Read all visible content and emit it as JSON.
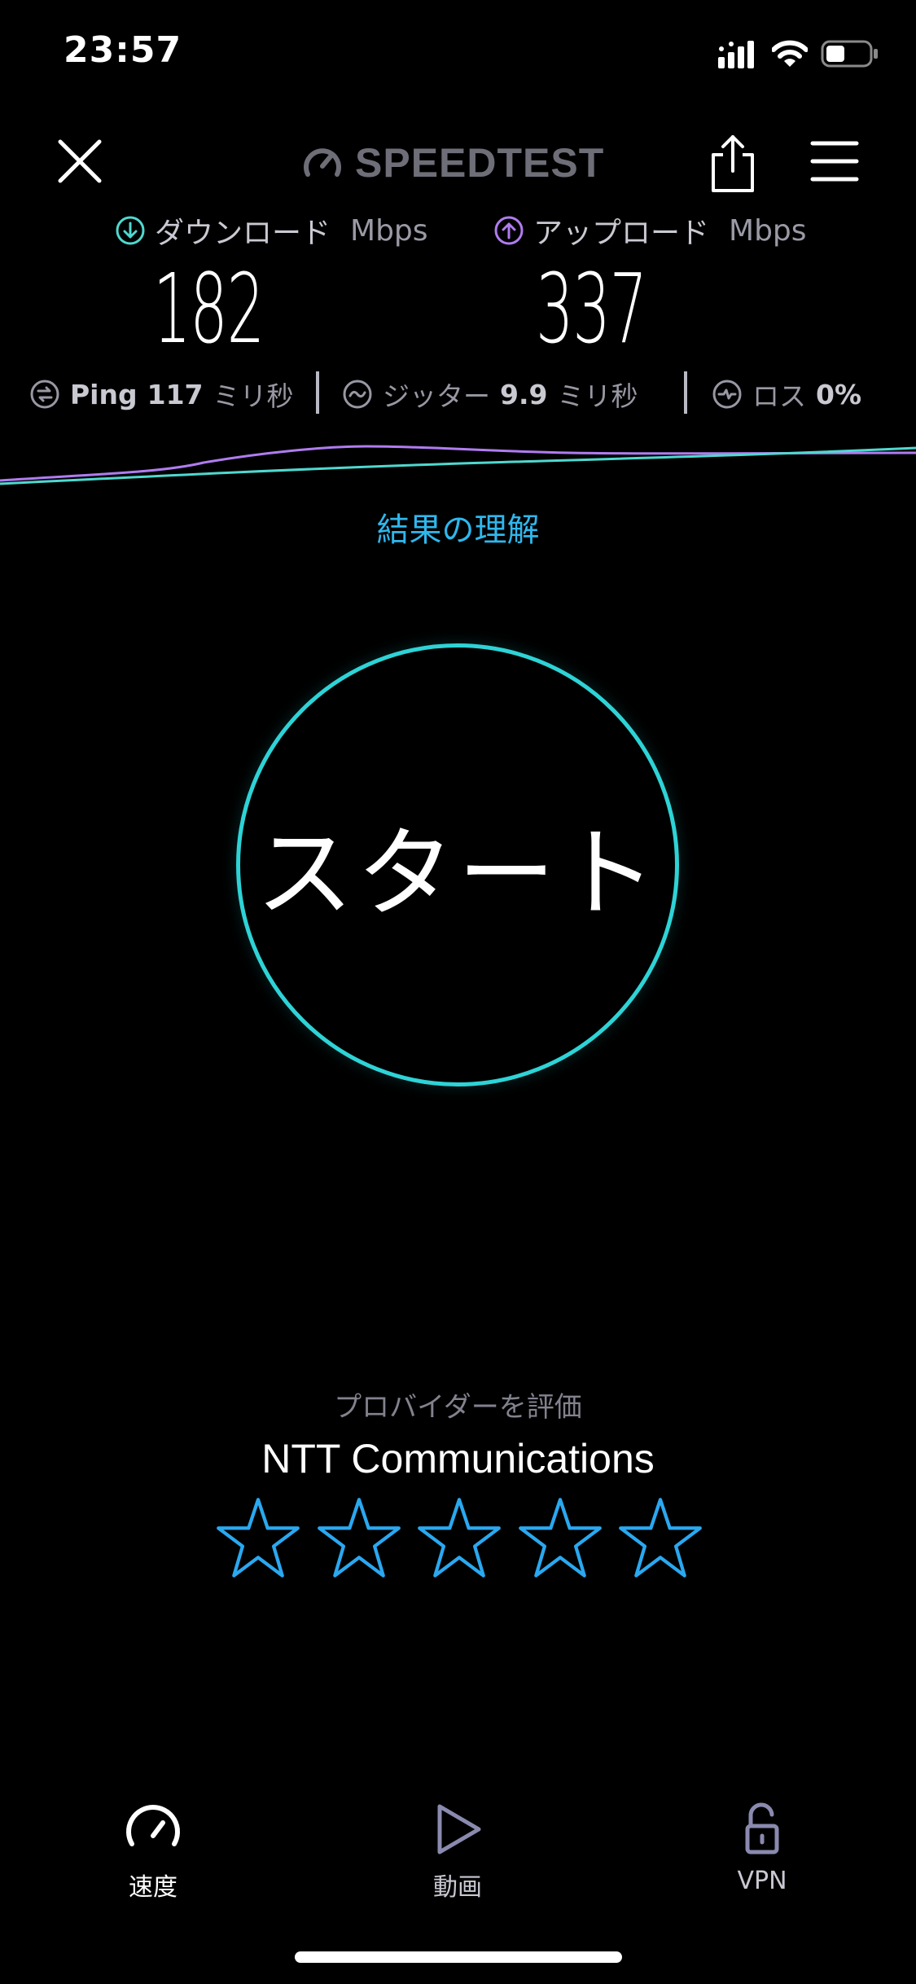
{
  "status_bar": {
    "time": "23:57",
    "icons": [
      "signal-icon",
      "wifi-icon",
      "battery-icon"
    ]
  },
  "header": {
    "logo": "SPEEDTEST",
    "buttons": [
      "close-icon",
      "share-icon",
      "menu-icon"
    ]
  },
  "results": {
    "download": {
      "label": "ダウンロード",
      "unit": "Mbps",
      "value": "182",
      "icon": "download-arrow-icon",
      "color": "#4fd8cf"
    },
    "upload": {
      "label": "アップロード",
      "unit": "Mbps",
      "value": "337",
      "icon": "upload-arrow-icon",
      "color": "#b07cf0"
    }
  },
  "stats": {
    "ping": {
      "label": "Ping",
      "value": "117",
      "unit": "ミリ秒",
      "icon": "ping-icon"
    },
    "jitter": {
      "label": "ジッター",
      "value": "9.9",
      "unit": "ミリ秒",
      "icon": "jitter-icon"
    },
    "loss": {
      "label": "ロス",
      "value": "0%",
      "icon": "loss-icon"
    }
  },
  "understand_link": "結果の理解",
  "start_button": "スタート",
  "rating": {
    "prompt": "プロバイダーを評価",
    "provider": "NTT Communications",
    "stars_total": 5,
    "stars_filled": 0,
    "star_color": "#2aa8f0"
  },
  "tabs": [
    {
      "label": "速度",
      "icon": "speedometer-icon",
      "active": true
    },
    {
      "label": "動画",
      "icon": "play-icon",
      "active": false
    },
    {
      "label": "VPN",
      "icon": "lock-icon",
      "active": false
    }
  ],
  "colors": {
    "background": "#000000",
    "accent_cyan": "#2ed3d6",
    "link_blue": "#2fb7ec"
  }
}
